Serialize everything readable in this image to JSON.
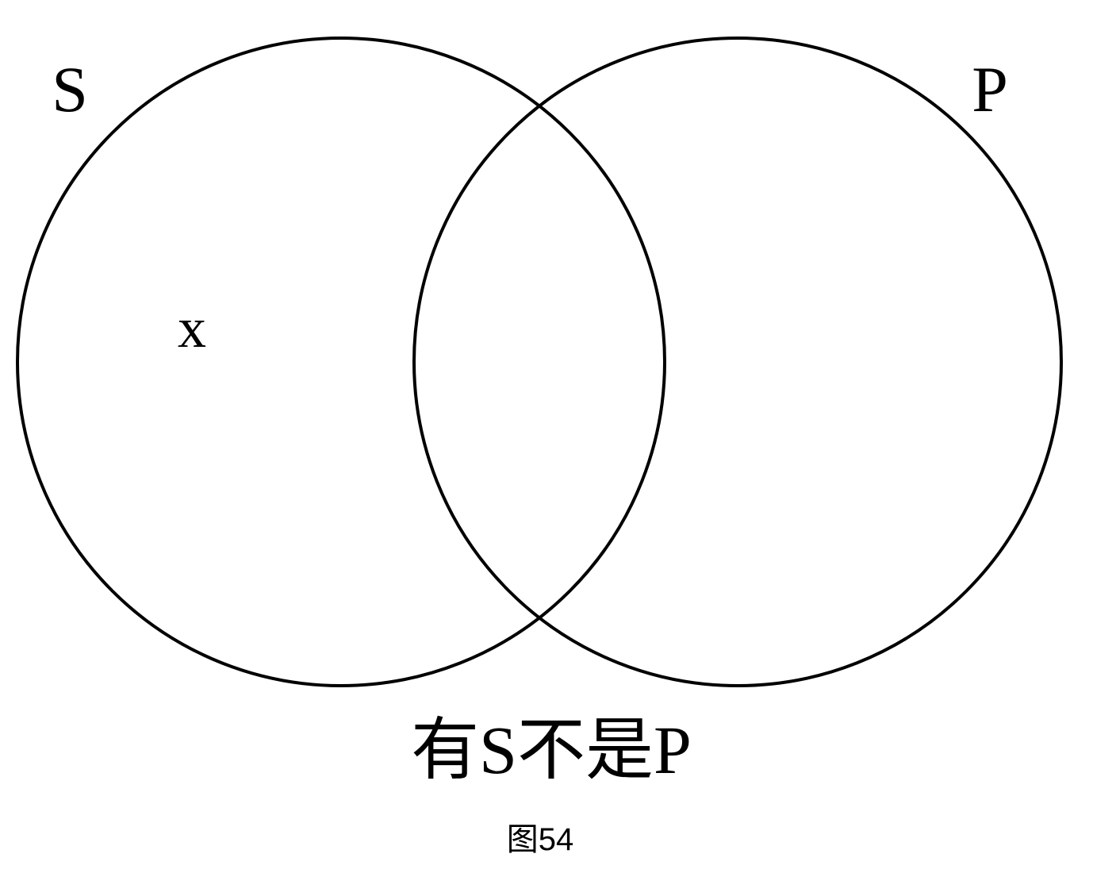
{
  "diagram": {
    "sets": [
      {
        "label": "S"
      },
      {
        "label": "P"
      }
    ],
    "marker": "x",
    "caption": "有S不是P",
    "figure_number": "图54"
  }
}
